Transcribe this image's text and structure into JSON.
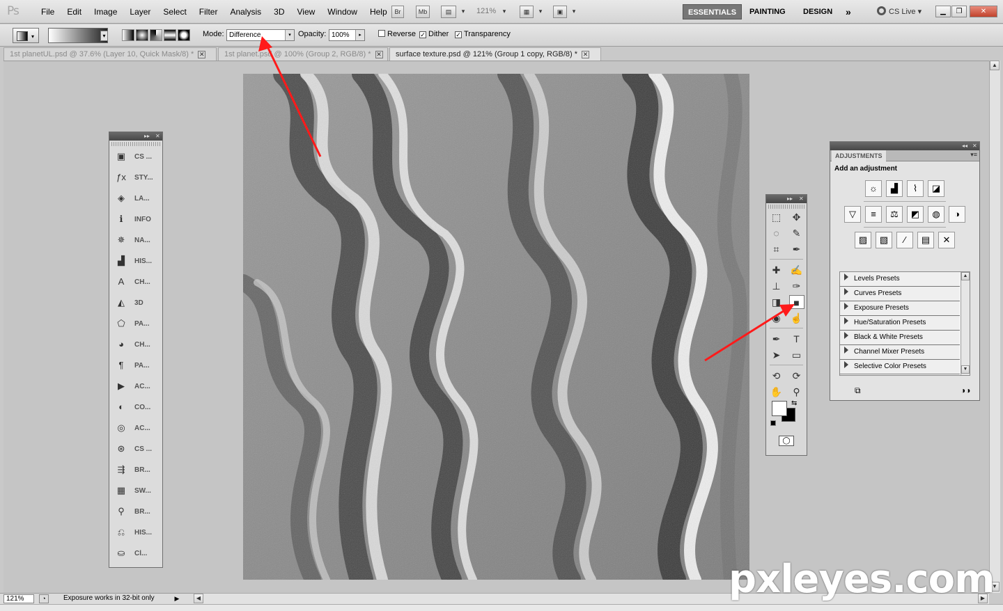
{
  "app": {
    "logo": "Ps"
  },
  "menu": [
    "File",
    "Edit",
    "Image",
    "Layer",
    "Select",
    "Filter",
    "Analysis",
    "3D",
    "View",
    "Window",
    "Help"
  ],
  "app_bar": {
    "bridge": "Br",
    "mini_bridge": "Mb",
    "zoom": "121%"
  },
  "workspaces": [
    "ESSENTIALS",
    "PAINTING",
    "DESIGN"
  ],
  "cs_live": "CS Live",
  "options": {
    "mode_label": "Mode:",
    "mode_value": "Difference",
    "opacity_label": "Opacity:",
    "opacity_value": "100%",
    "reverse_label": "Reverse",
    "dither_label": "Dither",
    "transparency_label": "Transparency",
    "reverse_checked": false,
    "dither_checked": true,
    "transparency_checked": true
  },
  "tabs": [
    {
      "title": "1st planetUL.psd @ 37.6% (Layer 10, Quick Mask/8) *",
      "active": false
    },
    {
      "title": "1st planet.psd @ 100% (Group 2, RGB/8) *",
      "active": false
    },
    {
      "title": "surface texture.psd @ 121% (Group 1 copy, RGB/8) *",
      "active": true
    }
  ],
  "dock_left": [
    {
      "icon": "cs-review-icon",
      "glyph": "▣",
      "label": "CS ..."
    },
    {
      "icon": "styles-icon",
      "glyph": "ƒx",
      "label": "STY..."
    },
    {
      "icon": "layers-icon",
      "glyph": "◈",
      "label": "LA..."
    },
    {
      "icon": "info-icon",
      "glyph": "ℹ",
      "label": "INFO"
    },
    {
      "icon": "navigator-icon",
      "glyph": "✵",
      "label": "NA..."
    },
    {
      "icon": "histogram-icon",
      "glyph": "▟",
      "label": "HIS..."
    },
    {
      "icon": "character-icon",
      "glyph": "A",
      "label": "CH..."
    },
    {
      "icon": "3d-icon",
      "glyph": "◭",
      "label": "3D"
    },
    {
      "icon": "paths-icon",
      "glyph": "⬠",
      "label": "PA..."
    },
    {
      "icon": "channels-icon",
      "glyph": "◕",
      "label": "CH..."
    },
    {
      "icon": "paragraph-icon",
      "glyph": "¶",
      "label": "PA..."
    },
    {
      "icon": "actions-icon",
      "glyph": "▶",
      "label": "AC..."
    },
    {
      "icon": "color-icon",
      "glyph": "◐",
      "label": "CO..."
    },
    {
      "icon": "animation-icon",
      "glyph": "◎",
      "label": "AC..."
    },
    {
      "icon": "clone-source-icon",
      "glyph": "⊛",
      "label": "CS ..."
    },
    {
      "icon": "brush-presets-icon",
      "glyph": "⇶",
      "label": "BR..."
    },
    {
      "icon": "swatches-icon",
      "glyph": "▦",
      "label": "SW..."
    },
    {
      "icon": "brushes-icon",
      "glyph": "⚲",
      "label": "BR..."
    },
    {
      "icon": "history-icon",
      "glyph": "⎌",
      "label": "HIS..."
    },
    {
      "icon": "clone-icon",
      "glyph": "⛀",
      "label": "Cl..."
    }
  ],
  "tools": [
    [
      "⬚",
      "✥"
    ],
    [
      "◌",
      "✎"
    ],
    [
      "⌗",
      "✒"
    ],
    [
      "✚",
      "✍"
    ],
    [
      "⊥",
      "✑"
    ],
    [
      "◨",
      "■"
    ],
    [
      "◉",
      "☝"
    ],
    [
      "✒",
      "T"
    ],
    [
      "➤",
      "▭"
    ],
    [
      "⟲",
      "⟳"
    ],
    [
      "✋",
      "⚲"
    ]
  ],
  "adjustments": {
    "tab": "ADJUSTMENTS",
    "title": "Add an adjustment",
    "row1": [
      "☼",
      "▟",
      "⌇",
      "◪"
    ],
    "row2": [
      "▽",
      "≡",
      "⚖",
      "◩",
      "◍",
      "◑"
    ],
    "row3": [
      "▨",
      "▧",
      "⁄",
      "▤",
      "✕"
    ],
    "presets": [
      "Levels Presets",
      "Curves Presets",
      "Exposure Presets",
      "Hue/Saturation Presets",
      "Black & White Presets",
      "Channel Mixer Presets",
      "Selective Color Presets"
    ]
  },
  "status": {
    "zoom": "121%",
    "text": "Exposure works in 32-bit only"
  },
  "watermark": "pxleyes.com",
  "colors": {
    "arrow": "#ff1a1a",
    "active_workspace": "#777777"
  }
}
